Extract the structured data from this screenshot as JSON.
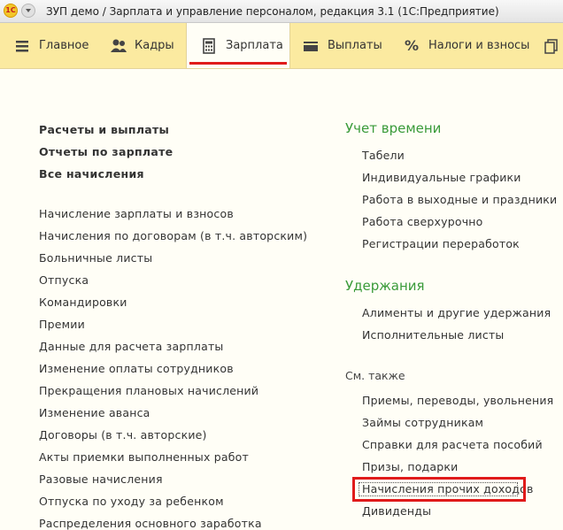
{
  "window": {
    "title": "ЗУП демо / Зарплата и управление персоналом, редакция 3.1  (1С:Предприятие)",
    "logo": "1С"
  },
  "sections": [
    {
      "label": "Главное",
      "icon": "menu-icon"
    },
    {
      "label": "Кадры",
      "icon": "people-icon"
    },
    {
      "label": "Зарплата",
      "icon": "calculator-icon",
      "active": true
    },
    {
      "label": "Выплаты",
      "icon": "wallet-icon"
    },
    {
      "label": "Налоги и взносы",
      "icon": "percent-icon"
    }
  ],
  "left": {
    "bold": [
      "Расчеты и выплаты",
      "Отчеты по зарплате",
      "Все начисления"
    ],
    "items": [
      "Начисление зарплаты и взносов",
      "Начисления по договорам (в т.ч. авторским)",
      "Больничные листы",
      "Отпуска",
      "Командировки",
      "Премии",
      "Данные для расчета зарплаты",
      "Изменение оплаты сотрудников",
      "Прекращения плановых начислений",
      "Изменение аванса",
      "Договоры (в т.ч. авторские)",
      "Акты приемки выполненных работ",
      "Разовые начисления",
      "Отпуска по уходу за ребенком",
      "Распределения основного заработка"
    ]
  },
  "right": {
    "time_heading": "Учет времени",
    "time_items": [
      "Табели",
      "Индивидуальные графики",
      "Работа в выходные и праздники",
      "Работа сверхурочно",
      "Регистрации переработок"
    ],
    "deductions_heading": "Удержания",
    "deductions_items": [
      "Алименты и другие удержания",
      "Исполнительные листы"
    ],
    "see_also_heading": "См. также",
    "see_also_items": [
      "Приемы, переводы, увольнения",
      "Займы сотрудникам",
      "Справки для расчета пособий",
      "Призы, подарки",
      "Начисления прочих доходов",
      "Дивиденды"
    ]
  },
  "colors": {
    "section_bar": "#fbeaa0",
    "heading_green": "#3a9b3a",
    "highlight_red": "#e01b1b"
  }
}
